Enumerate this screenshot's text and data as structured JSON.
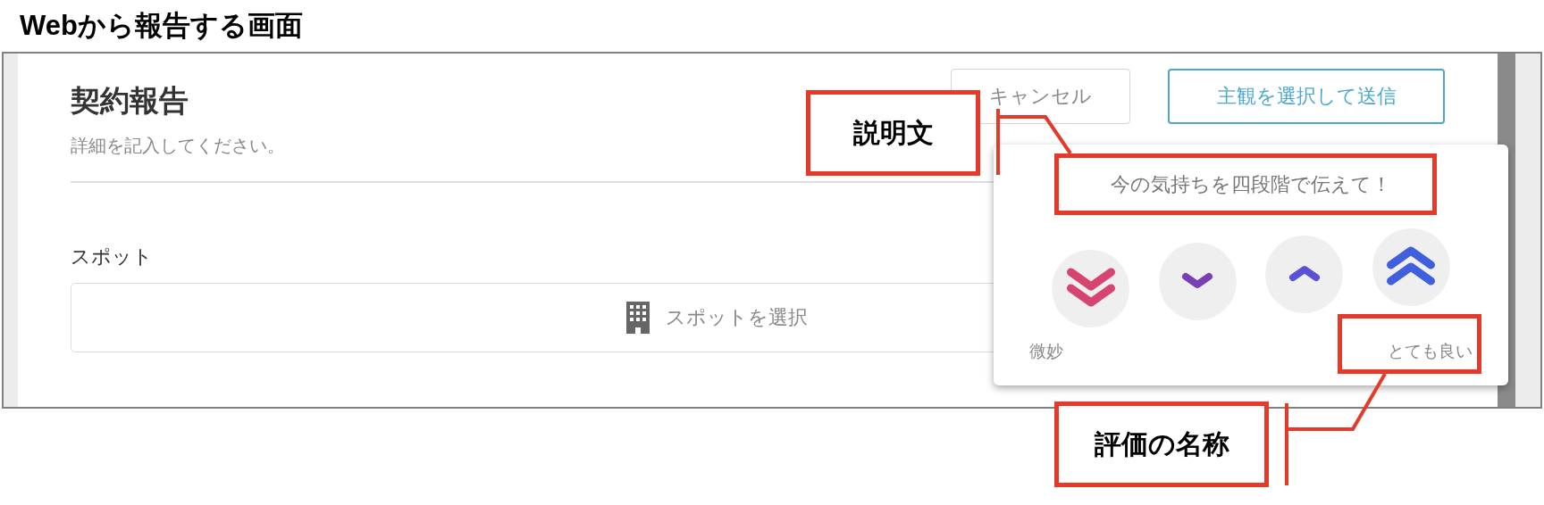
{
  "page_title": "Webから報告する画面",
  "form": {
    "title": "契約報告",
    "subtitle": "詳細を記入してください。",
    "buttons": [
      {
        "label": "キャンセル",
        "kind": "secondary"
      },
      {
        "label": "主観を選択して送信",
        "kind": "primary"
      }
    ],
    "spot": {
      "label": "スポット",
      "placeholder": "スポットを選択"
    }
  },
  "rating": {
    "description": "今の気持ちを四段階で伝えて！",
    "options": [
      {
        "kind": "double-down",
        "color": "#d6456f"
      },
      {
        "kind": "down",
        "color": "#7b3fb5"
      },
      {
        "kind": "up",
        "color": "#5a52d6"
      },
      {
        "kind": "double-up",
        "color": "#3f5fdf"
      }
    ],
    "low_label": "微妙",
    "high_label": "とても良い"
  },
  "annotations": [
    {
      "label": "説明文"
    },
    {
      "label": "評価の名称"
    }
  ]
}
